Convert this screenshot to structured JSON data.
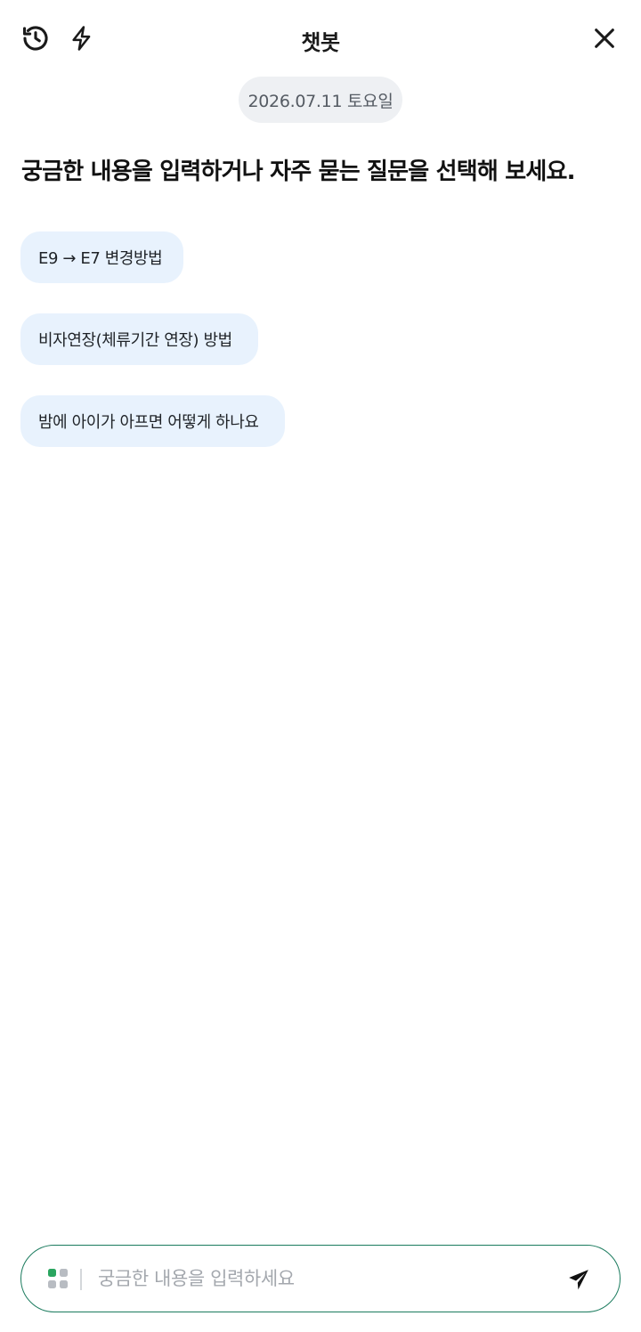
{
  "header": {
    "title": "챗봇",
    "history_icon": "history-clock-icon",
    "bolt_icon": "lightning-bolt-icon",
    "close_icon": "close-icon"
  },
  "date_label": "2026.07.11 토요일",
  "prompt_heading": "궁금한 내용을 입력하거나 자주 묻는 질문을 선택해 보세요.",
  "faq": [
    {
      "label": "E9 → E7 변경방법"
    },
    {
      "label": "비자연장(체류기간 연장) 방법"
    },
    {
      "label": "밤에 아이가 아프면 어떻게 하나요"
    }
  ],
  "input": {
    "value": "",
    "placeholder": "궁금한 내용을 입력하세요",
    "apps_icon": "apps-grid-icon",
    "send_icon": "send-paper-plane-icon"
  },
  "colors": {
    "accent_border": "#1b7b5e",
    "chip_bg": "#e8f2fd",
    "date_pill_bg": "#eef0f3",
    "apps_dot_green": "#2aa55f"
  }
}
